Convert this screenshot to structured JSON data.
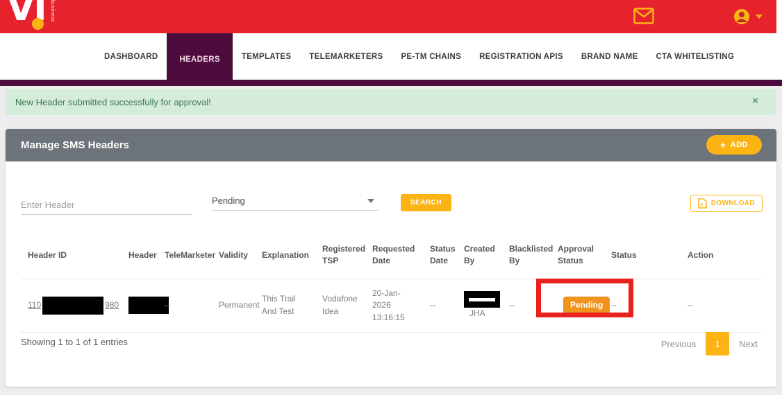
{
  "brand": {
    "logo_text": "VI",
    "logo_sub": "business"
  },
  "nav": {
    "items": [
      {
        "label": "DASHBOARD"
      },
      {
        "label": "HEADERS"
      },
      {
        "label": "TEMPLATES"
      },
      {
        "label": "TELEMARKETERS"
      },
      {
        "label": "PE-TM CHAINS"
      },
      {
        "label": "REGISTRATION APIS"
      },
      {
        "label": "BRAND NAME"
      },
      {
        "label": "CTA WHITELISTING"
      }
    ],
    "active_item": "HEADERS"
  },
  "alert": {
    "message": "New Header submitted successfully for approval!",
    "close_label": "×"
  },
  "panel": {
    "title": "Manage SMS Headers",
    "add_button_label": "ADD",
    "filters": {
      "header_placeholder": "Enter Header",
      "status_selected": "Pending",
      "search_label": "SEARCH",
      "download_label": "DOWNLOAD"
    },
    "table": {
      "columns": [
        "Header ID",
        "Header",
        "TeleMarketer",
        "Validity",
        "Explanation",
        "Registered TSP",
        "Requested Date",
        "Status Date",
        "Created By",
        "Blacklisted By",
        "Approval Status",
        "Status",
        "Action"
      ],
      "row": {
        "header_id_prefix": "110",
        "header_id_suffix": "980",
        "telemarketer": "--",
        "validity": "Permanent",
        "explanation": "This Trail And Test",
        "registered_tsp": "Vodafone Idea",
        "requested_date": "20-Jan-2026 13:16:15",
        "status_date": "--",
        "created_by": "JHA",
        "blacklisted_by": "--",
        "approval_status": "Pending",
        "status": "--",
        "action": "--"
      }
    },
    "footer": {
      "showing_text": "Showing 1 to 1 of 1 entries",
      "previous_label": "Previous",
      "current_page": "1",
      "next_label": "Next"
    }
  },
  "colors": {
    "brand_red": "#e6232d",
    "brand_yellow": "#fcb415",
    "brand_purple": "#4e0c3e",
    "pending_orange": "#f0941f",
    "annotation_red": "#e8231f",
    "panel_header_gray": "#6d737a",
    "alert_bg": "#d6ecdb",
    "alert_text": "#3c764f"
  }
}
